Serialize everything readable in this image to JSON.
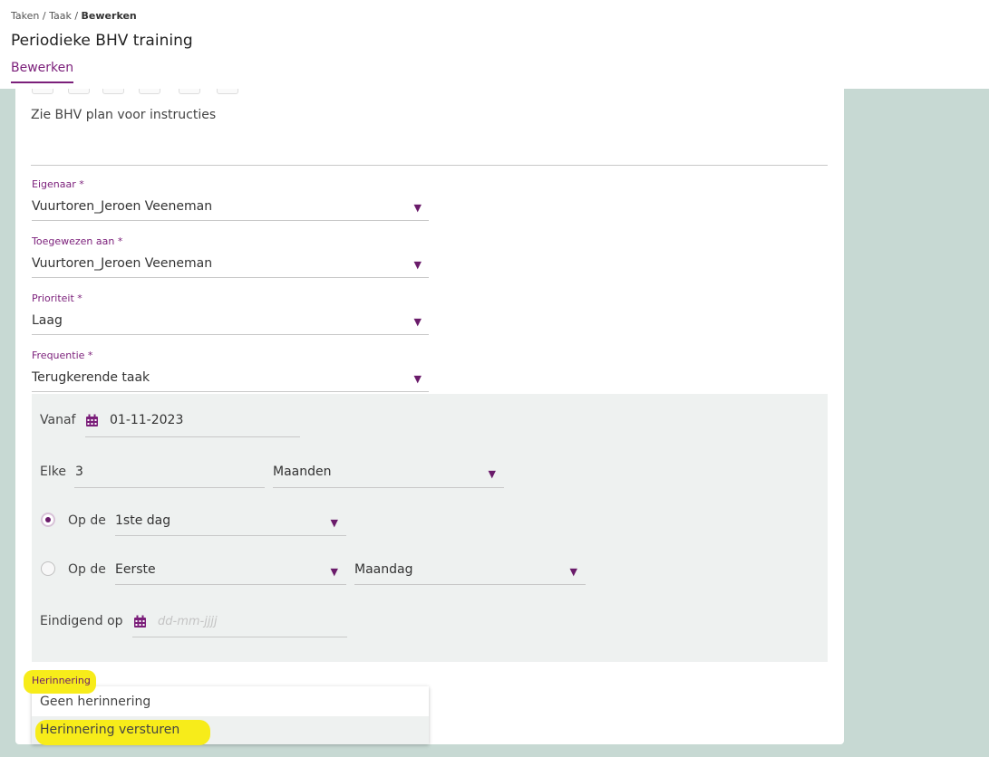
{
  "breadcrumb": {
    "part1": "Taken",
    "sep1": "/",
    "part2": "Taak",
    "sep2": "/",
    "current": "Bewerken"
  },
  "page_title": "Periodieke BHV training",
  "tabs": {
    "active": "Bewerken"
  },
  "description": "Zie BHV plan voor instructies",
  "fields": {
    "owner": {
      "label": "Eigenaar *",
      "value": "Vuurtoren_Jeroen Veeneman"
    },
    "assigned": {
      "label": "Toegewezen aan *",
      "value": "Vuurtoren_Jeroen Veeneman"
    },
    "priority": {
      "label": "Prioriteit *",
      "value": "Laag"
    },
    "frequency": {
      "label": "Frequentie *",
      "value": "Terugkerende taak"
    }
  },
  "recurrence": {
    "from_label": "Vanaf",
    "from_value": "01-11-2023",
    "every_label": "Elke",
    "every_value": "3",
    "unit_value": "Maanden",
    "on_label_1": "Op de",
    "day_value": "1ste dag",
    "on_label_2": "Op de",
    "ordinal_value": "Eerste",
    "weekday_value": "Maandag",
    "end_label": "Eindigend op",
    "end_placeholder": "dd-mm-jjjj"
  },
  "reminder": {
    "label": "Herinnering",
    "options": [
      "Geen herinnering",
      "Herinnering versturen"
    ]
  },
  "colors": {
    "accent": "#7b1f7a",
    "background": "#c7d9d3",
    "highlight": "#f7ec1a"
  },
  "icons": {
    "calendar": "calendar-icon",
    "caret": "caret-down-icon"
  }
}
